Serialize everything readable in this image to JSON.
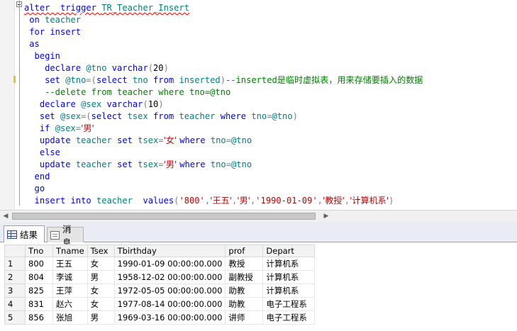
{
  "editor": {
    "lines": [
      [
        {
          "t": "alter  trigger ",
          "c": "kw squig"
        },
        {
          "t": "TR_Teacher_Insert",
          "c": "id squig"
        }
      ],
      [
        {
          "t": " on ",
          "c": "kw"
        },
        {
          "t": "teacher",
          "c": "id"
        }
      ],
      [
        {
          "t": " for ",
          "c": "kw"
        },
        {
          "t": "insert",
          "c": "kw"
        }
      ],
      [
        {
          "t": " as",
          "c": "kw"
        }
      ],
      [
        {
          "t": "  begin",
          "c": "kw"
        }
      ],
      [
        {
          "t": "    declare ",
          "c": "kw"
        },
        {
          "t": "@tno ",
          "c": "var"
        },
        {
          "t": "varchar",
          "c": "kw"
        },
        {
          "t": "(",
          "c": "op"
        },
        {
          "t": "20",
          "c": "num"
        },
        {
          "t": ")",
          "c": "op"
        }
      ],
      [
        {
          "t": "    set ",
          "c": "kw"
        },
        {
          "t": "@tno",
          "c": "var"
        },
        {
          "t": "=(",
          "c": "op"
        },
        {
          "t": "select ",
          "c": "kw"
        },
        {
          "t": "tno ",
          "c": "id"
        },
        {
          "t": "from ",
          "c": "kw"
        },
        {
          "t": "inserted",
          "c": "id"
        },
        {
          "t": ")",
          "c": "op"
        },
        {
          "t": "--inserted",
          "c": "cmt"
        },
        {
          "t": "是临时虚拟表，用来存储要插入的数据",
          "c": "cmt zh"
        }
      ],
      [
        {
          "t": "    --delete from teacher where tno=@tno",
          "c": "cmt"
        }
      ],
      [
        {
          "t": "   declare ",
          "c": "kw"
        },
        {
          "t": "@sex ",
          "c": "var"
        },
        {
          "t": "varchar",
          "c": "kw"
        },
        {
          "t": "(",
          "c": "op"
        },
        {
          "t": "10",
          "c": "num"
        },
        {
          "t": ")",
          "c": "op"
        }
      ],
      [
        {
          "t": "   set ",
          "c": "kw"
        },
        {
          "t": "@sex",
          "c": "var"
        },
        {
          "t": "=(",
          "c": "op"
        },
        {
          "t": "select ",
          "c": "kw"
        },
        {
          "t": "tsex ",
          "c": "id"
        },
        {
          "t": "from ",
          "c": "kw"
        },
        {
          "t": "teacher ",
          "c": "id"
        },
        {
          "t": "where ",
          "c": "kw"
        },
        {
          "t": "tno",
          "c": "id"
        },
        {
          "t": "=",
          "c": "op"
        },
        {
          "t": "@tno",
          "c": "var"
        },
        {
          "t": ")",
          "c": "op"
        }
      ],
      [
        {
          "t": "   if ",
          "c": "kw"
        },
        {
          "t": "@sex",
          "c": "var"
        },
        {
          "t": "=",
          "c": "op"
        },
        {
          "t": "'男'",
          "c": "str zh"
        }
      ],
      [
        {
          "t": "   update ",
          "c": "kw"
        },
        {
          "t": "teacher ",
          "c": "id"
        },
        {
          "t": "set ",
          "c": "kw"
        },
        {
          "t": "tsex",
          "c": "id"
        },
        {
          "t": "=",
          "c": "op"
        },
        {
          "t": "'女' ",
          "c": "str zh"
        },
        {
          "t": "where ",
          "c": "kw"
        },
        {
          "t": "tno",
          "c": "id"
        },
        {
          "t": "=",
          "c": "op"
        },
        {
          "t": "@tno",
          "c": "var"
        }
      ],
      [
        {
          "t": "   else",
          "c": "kw"
        }
      ],
      [
        {
          "t": "   update ",
          "c": "kw"
        },
        {
          "t": "teacher ",
          "c": "id"
        },
        {
          "t": "set ",
          "c": "kw"
        },
        {
          "t": "tsex",
          "c": "id"
        },
        {
          "t": "=",
          "c": "op"
        },
        {
          "t": "'男' ",
          "c": "str zh"
        },
        {
          "t": "where ",
          "c": "kw"
        },
        {
          "t": "tno",
          "c": "id"
        },
        {
          "t": "=",
          "c": "op"
        },
        {
          "t": "@tno",
          "c": "var"
        }
      ],
      [
        {
          "t": "  end",
          "c": "kw"
        }
      ],
      [
        {
          "t": "  go",
          "c": "kw"
        }
      ],
      [
        {
          "t": "  insert ",
          "c": "kw"
        },
        {
          "t": "into ",
          "c": "kw"
        },
        {
          "t": "teacher  ",
          "c": "id"
        },
        {
          "t": "values",
          "c": "kw"
        },
        {
          "t": "(",
          "c": "op"
        },
        {
          "t": "'800'",
          "c": "str"
        },
        {
          "t": ",",
          "c": "op"
        },
        {
          "t": "'王五'",
          "c": "str zh"
        },
        {
          "t": ",",
          "c": "op"
        },
        {
          "t": "'男'",
          "c": "str zh"
        },
        {
          "t": ",",
          "c": "op"
        },
        {
          "t": "'1990-01-09'",
          "c": "str"
        },
        {
          "t": ",",
          "c": "op"
        },
        {
          "t": "'教授'",
          "c": "str zh"
        },
        {
          "t": ",",
          "c": "op"
        },
        {
          "t": "'计算机系'",
          "c": "str zh"
        },
        {
          "t": ")",
          "c": "op"
        }
      ]
    ]
  },
  "results": {
    "tabs": [
      {
        "label": "结果",
        "icon": "grid-icon",
        "active": true
      },
      {
        "label": "消息",
        "icon": "message-icon",
        "active": false
      }
    ],
    "columns": [
      "Tno",
      "Tname",
      "Tsex",
      "Tbirthday",
      "prof",
      "Depart"
    ],
    "rows": [
      {
        "n": "1",
        "cells": [
          "800",
          "王五",
          "女",
          "1990-01-09 00:00:00.000",
          "教授",
          "计算机系"
        ]
      },
      {
        "n": "2",
        "cells": [
          "804",
          "李诚",
          "男",
          "1958-12-02 00:00:00.000",
          "副教授",
          "计算机系"
        ]
      },
      {
        "n": "3",
        "cells": [
          "825",
          "王萍",
          "女",
          "1972-05-05 00:00:00.000",
          "助教",
          "计算机系"
        ]
      },
      {
        "n": "4",
        "cells": [
          "831",
          "赵六",
          "女",
          "1977-08-14 00:00:00.000",
          "助教",
          "电子工程系"
        ]
      },
      {
        "n": "5",
        "cells": [
          "856",
          "张旭",
          "男",
          "1969-03-16 00:00:00.000",
          "讲师",
          "电子工程系"
        ]
      }
    ]
  },
  "colors": {
    "keyword": "#0000ff",
    "identifier": "#008080",
    "comment": "#008000",
    "string": "#c00000",
    "operator": "#808080"
  }
}
